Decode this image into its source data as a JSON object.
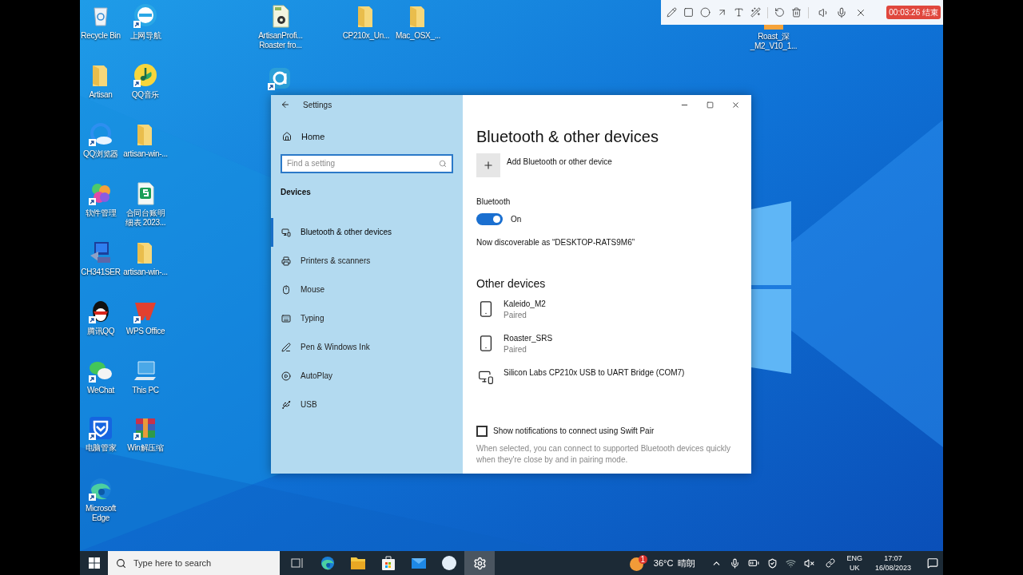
{
  "desktop": {
    "icons": [
      {
        "label": "Recycle Bin",
        "kind": "recycle-bin",
        "shortcut": false
      },
      {
        "label": "上网导航",
        "kind": "browser-e",
        "shortcut": true
      },
      {
        "lines": [
          "ArtisanProfi...",
          "Roaster fro..."
        ],
        "kind": "document-gear",
        "shortcut": false
      },
      {
        "label": "CP210x_Un...",
        "kind": "folder",
        "shortcut": false
      },
      {
        "label": "Mac_OSX_...",
        "kind": "folder",
        "shortcut": false
      },
      {
        "lines": [
          "Roast_深",
          "_M2_V10_1..."
        ],
        "kind": "document-strip",
        "shortcut": false
      },
      {
        "label": "Artisan",
        "kind": "folder",
        "shortcut": false
      },
      {
        "label": "QQ音乐",
        "kind": "music",
        "shortcut": true
      },
      {
        "kind": "app-a",
        "shortcut": true
      },
      {
        "label": "QQ浏览器",
        "kind": "cloud-browser",
        "shortcut": true
      },
      {
        "label": "artisan-win-...",
        "kind": "folder",
        "shortcut": false
      },
      {
        "label": "软件管理",
        "kind": "petals",
        "shortcut": true
      },
      {
        "lines": [
          "合同台账明",
          "细表 2023..."
        ],
        "kind": "spreadsheet",
        "shortcut": false
      },
      {
        "label": "CH341SER",
        "kind": "installer",
        "shortcut": false
      },
      {
        "label": "artisan-win-...",
        "kind": "folder",
        "shortcut": false
      },
      {
        "label": "腾讯QQ",
        "kind": "penguin",
        "shortcut": true
      },
      {
        "label": "WPS Office",
        "kind": "wps",
        "shortcut": true
      },
      {
        "label": "WeChat",
        "kind": "chat",
        "shortcut": true
      },
      {
        "label": "This PC",
        "kind": "monitor",
        "shortcut": false
      },
      {
        "label": "电脑管家",
        "kind": "shield",
        "shortcut": true
      },
      {
        "label": "Win解压缩",
        "kind": "archive",
        "shortcut": true
      },
      {
        "lines": [
          "Microsoft",
          "Edge"
        ],
        "kind": "edge",
        "shortcut": true
      }
    ]
  },
  "recorder_toolbar": {
    "timer": "00:03:26 结束"
  },
  "settings_window": {
    "title": "Settings",
    "sidebar": {
      "home": "Home",
      "search": {
        "placeholder": "Find a setting"
      },
      "section": "Devices",
      "items": [
        {
          "label": "Bluetooth & other devices",
          "kind": "devices",
          "selected": true
        },
        {
          "label": "Printers & scanners",
          "kind": "printer",
          "selected": false
        },
        {
          "label": "Mouse",
          "kind": "mouse",
          "selected": false
        },
        {
          "label": "Typing",
          "kind": "keyboard",
          "selected": false
        },
        {
          "label": "Pen & Windows Ink",
          "kind": "pen",
          "selected": false
        },
        {
          "label": "AutoPlay",
          "kind": "autoplay",
          "selected": false
        },
        {
          "label": "USB",
          "kind": "usb",
          "selected": false
        }
      ]
    },
    "content": {
      "title": "Bluetooth & other devices",
      "add_button": "Add Bluetooth or other device",
      "bluetooth": {
        "label": "Bluetooth",
        "on": true,
        "state_text": "On"
      },
      "discoverable": "Now discoverable as “DESKTOP-RATS9M6”",
      "other_devices": {
        "heading": "Other devices",
        "devices": [
          {
            "name": "Kaleido_M2",
            "status": "Paired",
            "kind": "phone"
          },
          {
            "name": "Roaster_SRS",
            "status": "Paired",
            "kind": "phone"
          },
          {
            "name": "Silicon Labs CP210x USB to UART Bridge (COM7)",
            "kind": "pc"
          }
        ]
      },
      "swift_pair": {
        "label": "Show notifications to connect using Swift Pair",
        "checked": false,
        "description": "When selected, you can connect to supported Bluetooth devices quickly when they're close by and in pairing mode."
      }
    }
  },
  "taskbar": {
    "search": {
      "placeholder": "Type here to search"
    },
    "apps": [
      {
        "kind": "task-view",
        "active": false
      },
      {
        "kind": "edge",
        "active": false
      },
      {
        "kind": "explorer",
        "active": false
      },
      {
        "kind": "store",
        "active": false
      },
      {
        "kind": "mail",
        "active": false
      },
      {
        "kind": "circle-app",
        "active": false
      },
      {
        "kind": "settings",
        "active": true
      }
    ],
    "weather": {
      "badge": "1",
      "temperature": "36°C",
      "condition": "晴朗"
    },
    "language": {
      "code": "ENG",
      "region": "UK"
    },
    "clock": {
      "time": "17:07",
      "date": "16/08/2023"
    }
  }
}
